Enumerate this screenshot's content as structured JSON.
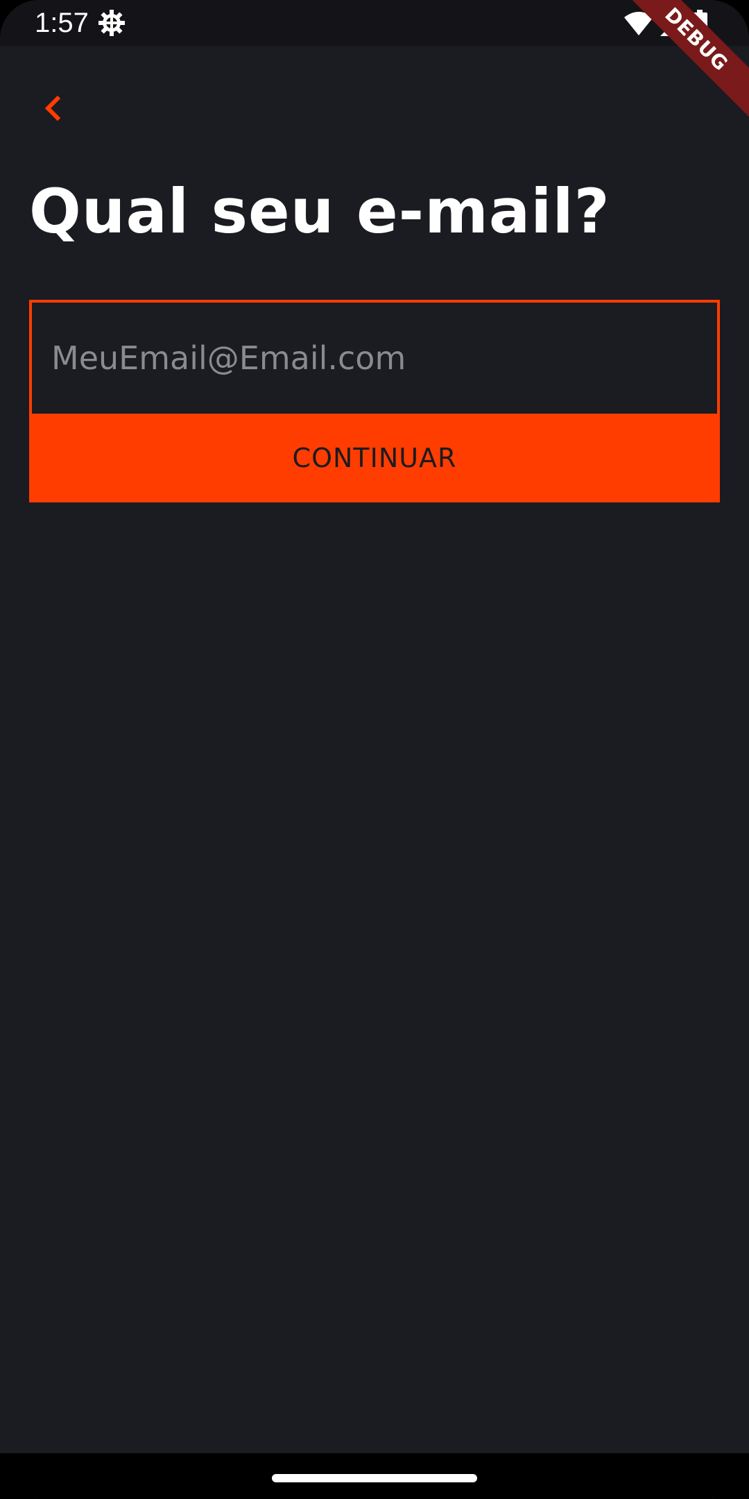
{
  "status_bar": {
    "time": "1:57",
    "icons": [
      "gear-icon",
      "wifi-icon",
      "cellular-icon",
      "battery-icon"
    ]
  },
  "debug_ribbon": {
    "label": "DEBUG"
  },
  "header": {
    "back_icon": "chevron-left-icon"
  },
  "main": {
    "title": "Qual seu e-mail?",
    "email_input": {
      "placeholder": "MeuEmail@Email.com",
      "value": ""
    },
    "continue_label": "CONTINUAR"
  },
  "colors": {
    "background": "#1b1b22",
    "accent": "#ff3d00",
    "status_bar": "#131318",
    "placeholder": "#8a8a8f",
    "ribbon": "#7a1a1a"
  }
}
